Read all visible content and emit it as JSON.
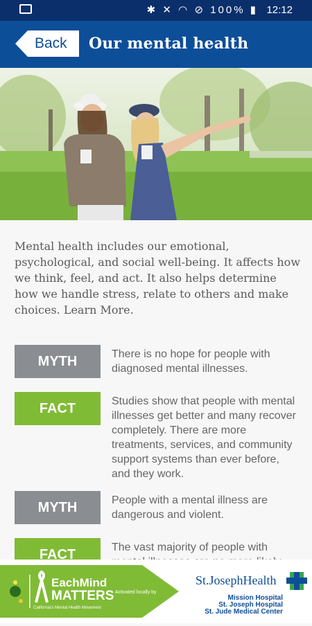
{
  "status_bar": {
    "battery": "100%",
    "time": "12:12"
  },
  "header": {
    "back_label": "Back",
    "title": "Our mental health"
  },
  "intro": "Mental health includes our emotional, psychological, and social well-being. It affects how we think, feel, and act. It also helps determine how we handle stress, relate to others and make choices. Learn More.",
  "items": [
    {
      "tag": "MYTH",
      "text": "There is no hope for people with diagnosed mental illnesses."
    },
    {
      "tag": "FACT",
      "text": "Studies show that people with mental illnesses get better and many recover completely. There are more treatments, services, and community support systems than ever before, and they work."
    },
    {
      "tag": "MYTH",
      "text": "People with a mental illness are dangerous and violent."
    },
    {
      "tag": "FACT",
      "text": "The vast majority of people with mental illnesses are no more likely"
    }
  ],
  "footer": {
    "brand_line1": "EachMind",
    "brand_line2": "MATTERS",
    "brand_tagline": "California's Mental Health Movement",
    "activated": "Activated locally by",
    "partner": "St.JosephHealth",
    "hospitals": [
      "Mission Hospital",
      "St. Joseph Hospital",
      "St. Jude Medical Center"
    ]
  },
  "colors": {
    "status_bar": "#0b2f6b",
    "app_bar": "#0d4e99",
    "myth": "#8a8d92",
    "fact": "#80bb35"
  }
}
